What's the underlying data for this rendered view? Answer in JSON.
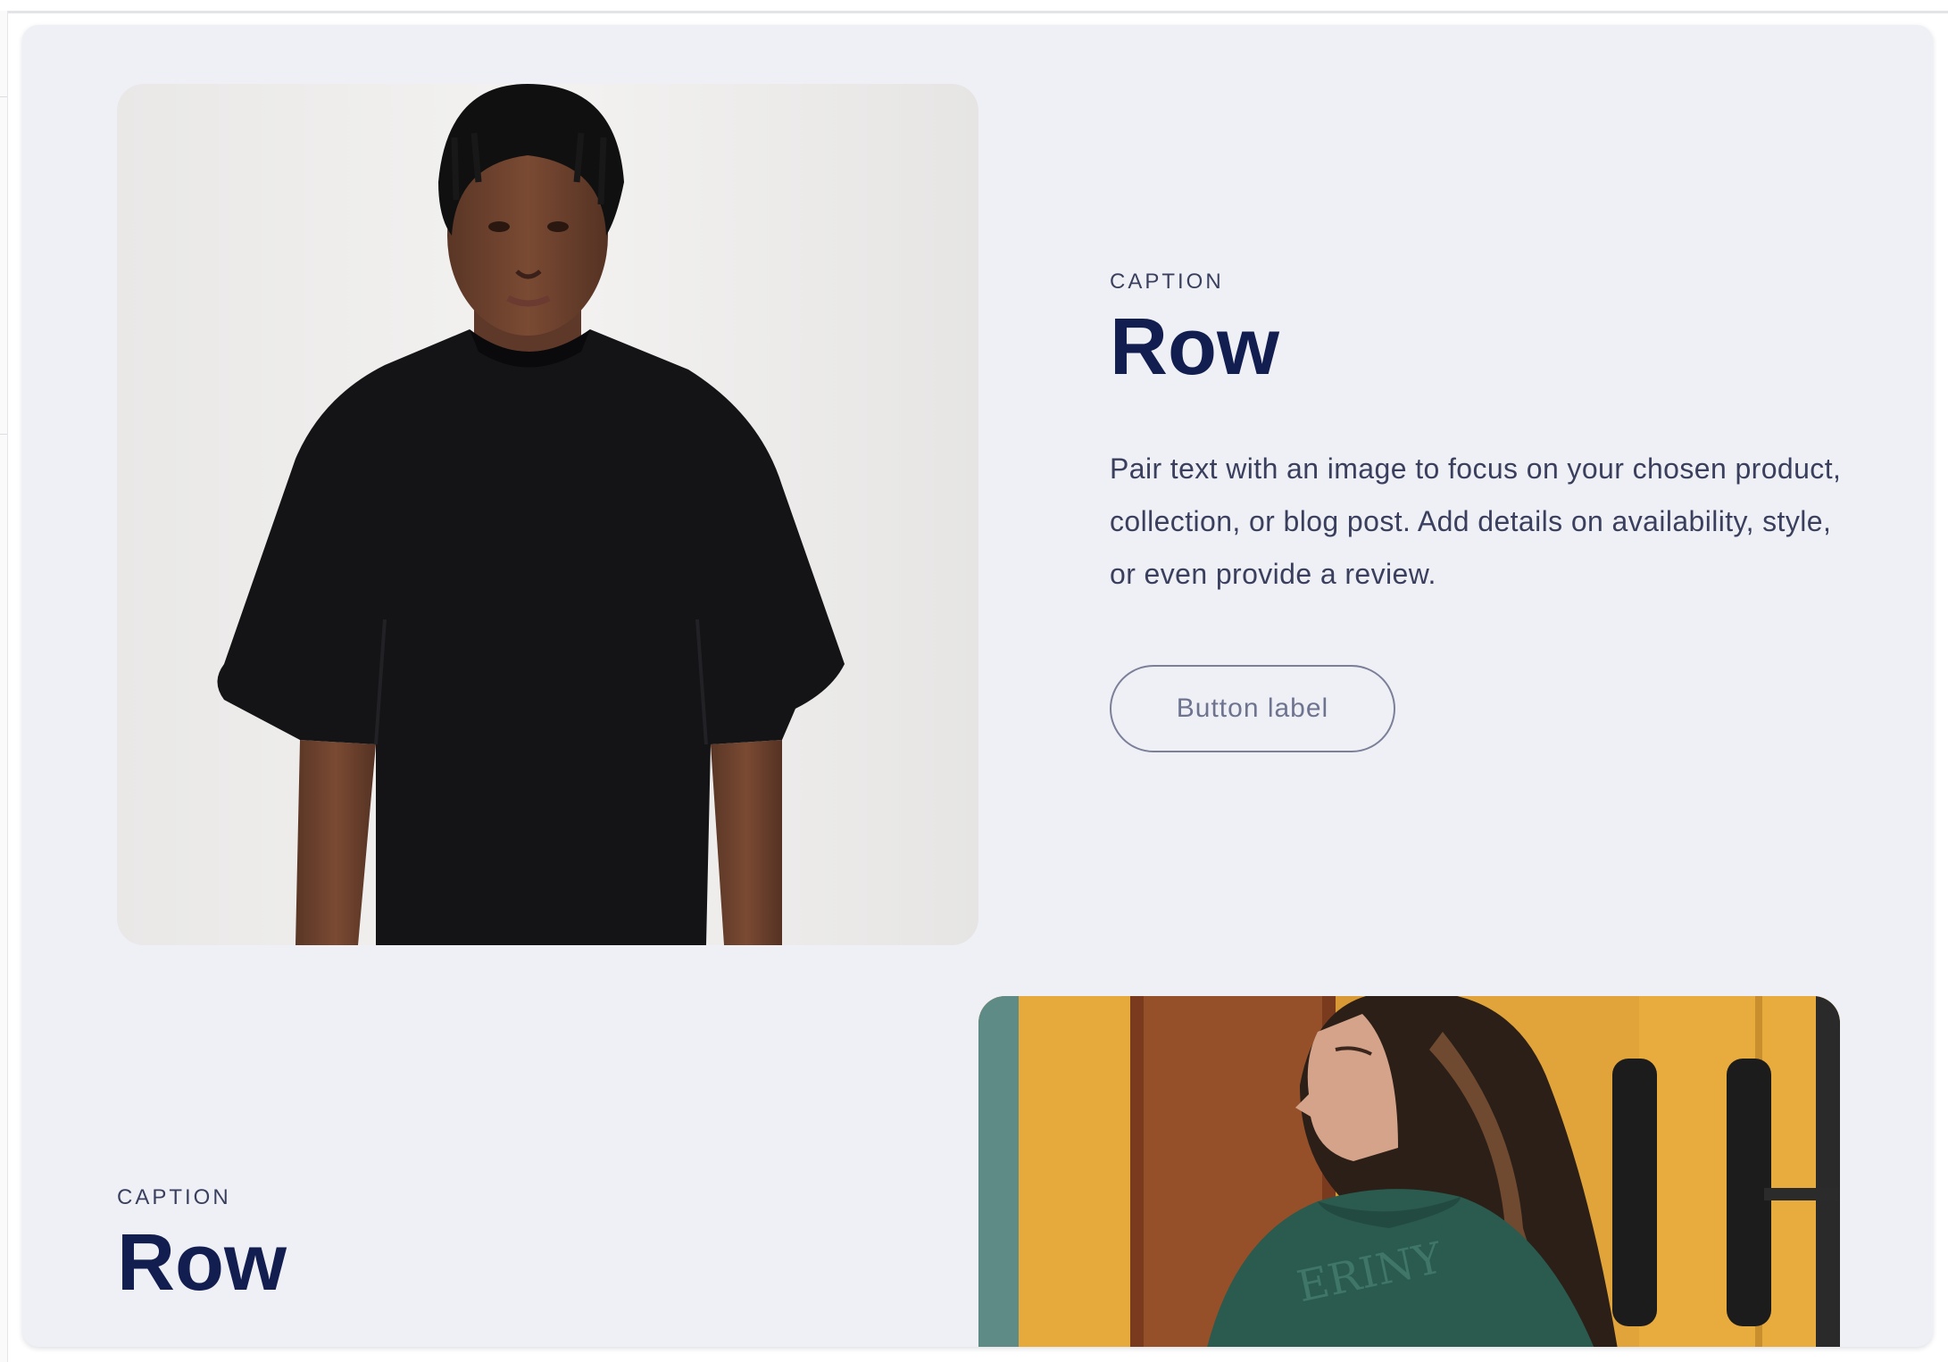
{
  "rows": [
    {
      "caption": "CAPTION",
      "heading": "Row",
      "body": "Pair text with an image to focus on your chosen product, collection, or blog post. Add details on availability, style, or even provide a review.",
      "button_label": "Button label",
      "image": "man-in-black-tshirt-photo"
    },
    {
      "caption": "CAPTION",
      "heading": "Row",
      "image": "woman-in-green-sweatshirt-photo"
    }
  ],
  "colors": {
    "card_background": "#eff0f5",
    "heading": "#121d50",
    "text": "#3a3f5e",
    "button_border": "#7b7f98"
  }
}
